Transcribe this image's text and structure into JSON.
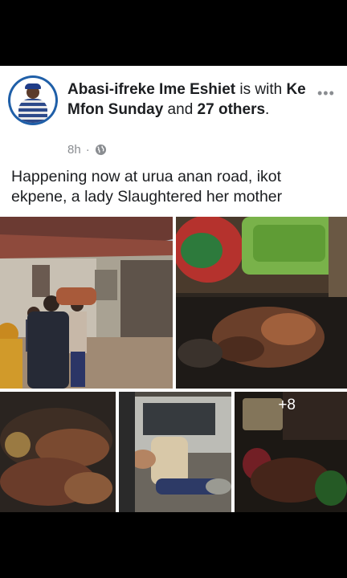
{
  "post": {
    "author": "Abasi-ifreke Ime Eshiet",
    "with_text": " is with ",
    "tagged": "Ke Mfon Sunday",
    "and_text": " and ",
    "others": "27 others",
    "period": ".",
    "time": "8h",
    "separator": "·",
    "audience_icon": "globe-icon",
    "more_label": "•••",
    "text": "Happening now at urua anan road, ikot ekpene, a lady Slaughtered her mother",
    "more_photos": "+8"
  },
  "colors": {
    "avatar_ring": "#1f5fa8",
    "meta_gray": "#8a8d91",
    "text": "#1c1e21"
  }
}
